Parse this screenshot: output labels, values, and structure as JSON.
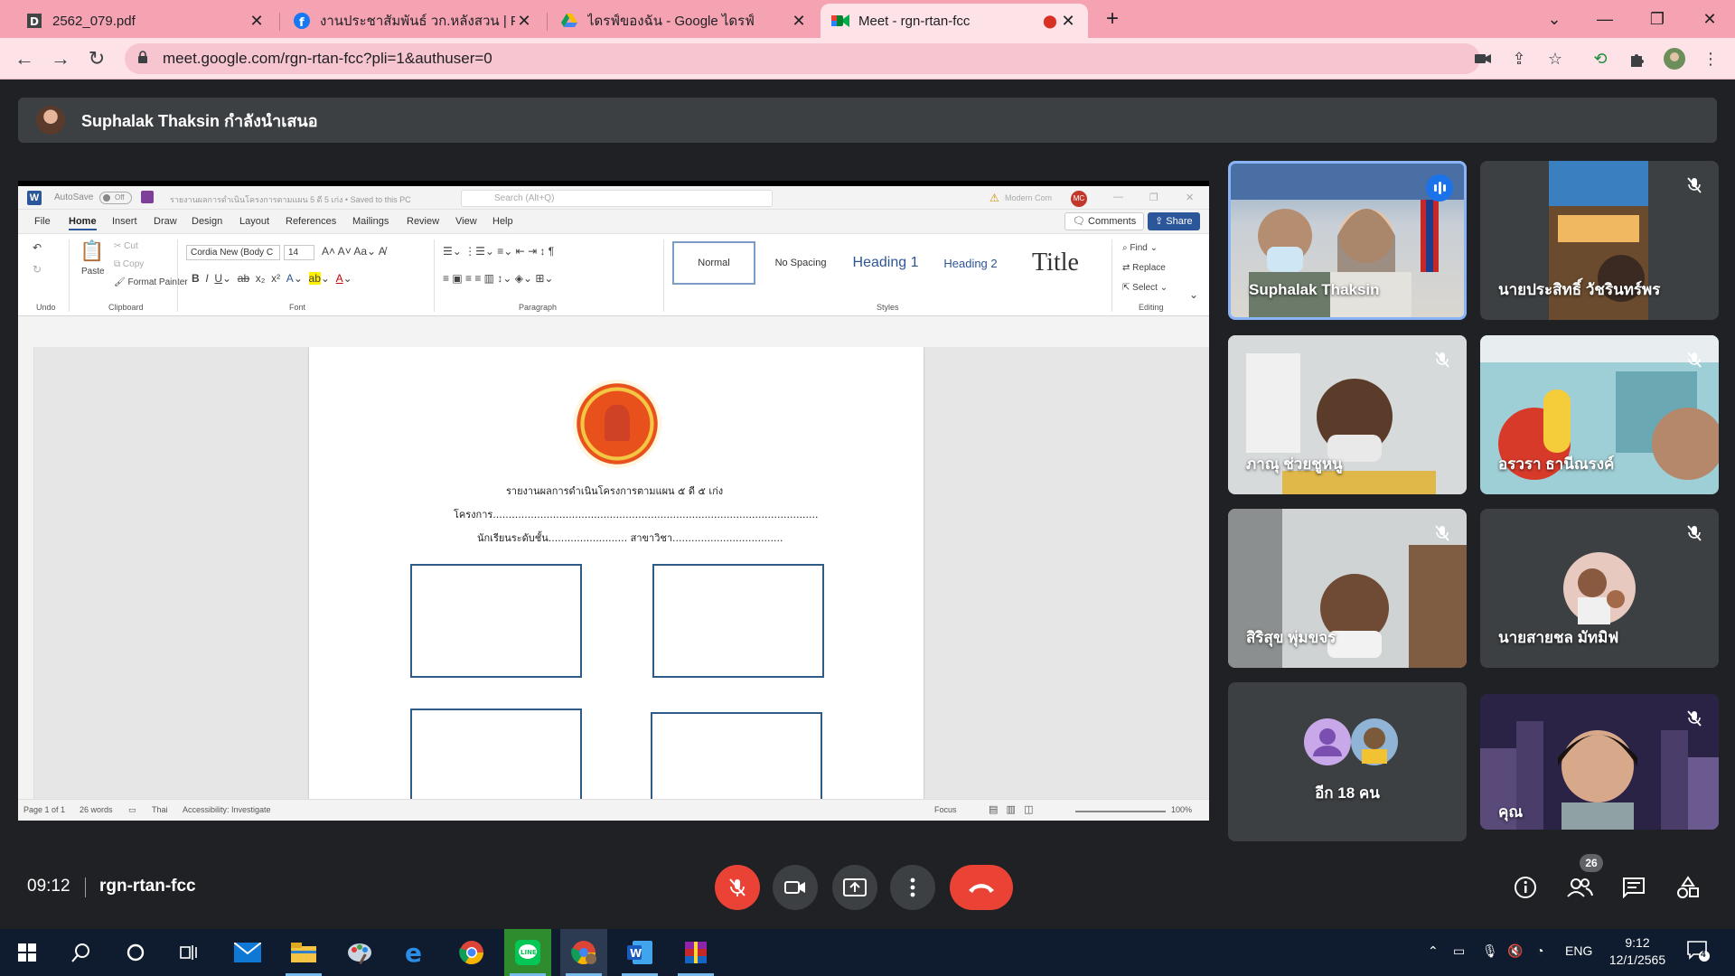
{
  "browser": {
    "tabs": [
      {
        "title": "2562_079.pdf",
        "icon": "pdf-icon"
      },
      {
        "title": "งานประชาสัมพันธ์ วก.หลังสวน | Faceb",
        "icon": "facebook-icon"
      },
      {
        "title": "ไดรฟ์ของฉัน - Google ไดรฟ์",
        "icon": "google-drive-icon"
      },
      {
        "title": "Meet - rgn-rtan-fcc",
        "icon": "google-meet-icon",
        "active": true,
        "recording": true
      }
    ],
    "url": "meet.google.com/rgn-rtan-fcc?pli=1&authuser=0",
    "tab_color": "#f5a3b3"
  },
  "meet": {
    "presenter_banner": "Suphalak Thaksin กำลังนำเสนอ",
    "time": "09:12",
    "meeting_code": "rgn-rtan-fcc",
    "participant_count": "26",
    "participants": [
      {
        "name": "Suphalak Thaksin",
        "speaking": true
      },
      {
        "name": "นายประสิทธิ์ วัชรินทร์พร",
        "muted": true
      },
      {
        "name": "ภาณุ ช่วยชูหนู",
        "muted": true
      },
      {
        "name": "อรวรา ธานีณรงค์",
        "muted": true
      },
      {
        "name": "สิริสุข พุ่มขจร",
        "muted": true
      },
      {
        "name": "นายสายชล มัทมิฟ",
        "muted": true
      },
      {
        "name": "อีก 18 คน"
      },
      {
        "name": "คุณ",
        "muted": true
      }
    ]
  },
  "word": {
    "autosave": "AutoSave",
    "autosave_state": "Off",
    "doc_title": "รายงานผลการดำเนินโครงการตามแผน 5 ดี 5 เก่ง • Saved to this PC",
    "search_placeholder": "Search (Alt+Q)",
    "user": "Modern Com",
    "user_initials": "MC",
    "menu": [
      "File",
      "Home",
      "Insert",
      "Draw",
      "Design",
      "Layout",
      "References",
      "Mailings",
      "Review",
      "View",
      "Help"
    ],
    "active_menu": "Home",
    "comments": "Comments",
    "share": "Share",
    "ribbon": {
      "undo": "Undo",
      "paste": "Paste",
      "cut": "Cut",
      "copy": "Copy",
      "format_painter": "Format Painter",
      "clipboard": "Clipboard",
      "font_name": "Cordia New (Body C",
      "font_size": "14",
      "font": "Font",
      "paragraph": "Paragraph",
      "styles_label": "Styles",
      "styles": [
        "Normal",
        "No Spacing",
        "Heading 1",
        "Heading 2",
        "Title"
      ],
      "find": "Find",
      "replace": "Replace",
      "select": "Select",
      "editing": "Editing"
    },
    "document": {
      "heading": "รายงานผลการดำเนินโครงการตามแผน ๕ ดี ๕ เก่ง",
      "project_line": "โครงการ.......................................................................................................",
      "student_line": "นักเรียนระดับชั้น......................... สาขาวิชา..................................."
    },
    "status": {
      "page": "Page 1 of 1",
      "words": "26 words",
      "language": "Thai",
      "accessibility": "Accessibility: Investigate",
      "focus": "Focus",
      "zoom": "100%"
    }
  },
  "taskbar": {
    "lang": "ENG",
    "time": "9:12",
    "date": "12/1/2565",
    "notifications": "4"
  }
}
